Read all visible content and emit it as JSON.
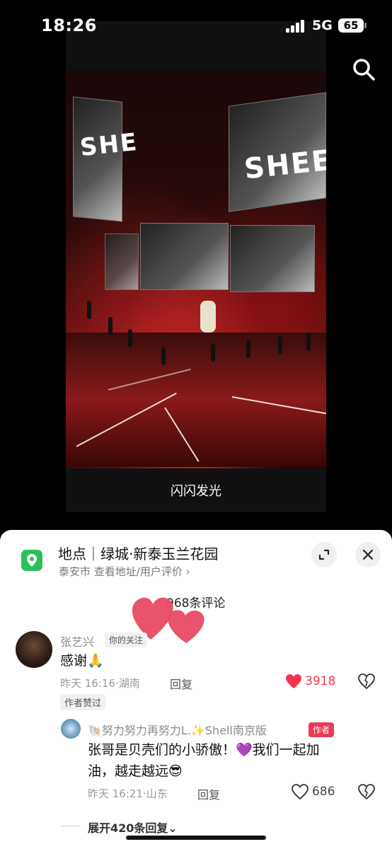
{
  "status": {
    "time": "18:26",
    "network": "5G",
    "battery": "65"
  },
  "video": {
    "caption": "闪闪发光",
    "screen_text_left": "SHE",
    "screen_text_right": "SHEE"
  },
  "location": {
    "title": "地点｜绿城·新泰玉兰花园",
    "subtitle": "泰安市  查看地址/用户评价 ›"
  },
  "comments_header": {
    "count_text": "968条评论"
  },
  "comments": [
    {
      "username": "张艺兴",
      "badge": "你的关注",
      "text": "感谢🙏",
      "meta": "昨天 16:16·湖南",
      "reply_label": "回复",
      "likes": "3918",
      "liked": true,
      "author_liked": "作者赞过"
    }
  ],
  "reply": {
    "username": "🐚努力努力再努力L.✨Shell南京版",
    "author_tag": "作者",
    "text_line1": "张哥是贝壳们的小骄傲！💜我们一起加",
    "text_line2": "油，越走越远😎",
    "meta": "昨天 16:21·山东",
    "reply_label": "回复",
    "likes": "686"
  },
  "expand": {
    "label": "展开420条回复⌄"
  },
  "colors": {
    "accent_red": "#ea3a55",
    "like_red": "#f5334f",
    "location_green": "#2bbf5a"
  }
}
